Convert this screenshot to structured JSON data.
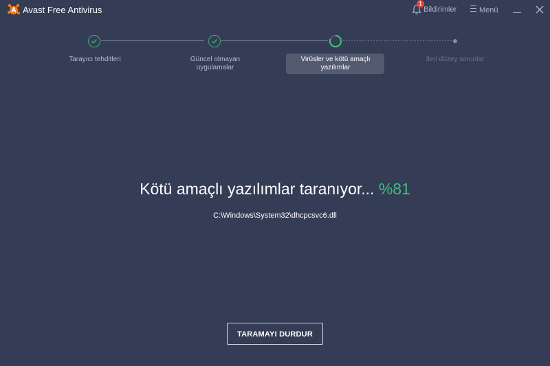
{
  "app": {
    "title": "Avast Free Antivirus"
  },
  "header": {
    "notifications_label": "Bildirimler",
    "notifications_count": "1",
    "menu_label": "Menü"
  },
  "steps": [
    {
      "label_line1": "Tarayıcı tehditleri",
      "label_line2": "",
      "state": "done"
    },
    {
      "label_line1": "Güncel olmayan",
      "label_line2": "uygulamalar",
      "state": "done"
    },
    {
      "label_line1": "Virüsler ve kötü amaçlı",
      "label_line2": "yazılımlar",
      "state": "active"
    },
    {
      "label_line1": "İleri düzey sorunlar",
      "label_line2": "",
      "state": "pending"
    }
  ],
  "scan": {
    "heading": "Kötü amaçlı yazılımlar taranıyor...",
    "percent": "%81",
    "progress": 0.81,
    "current_file": "C:\\Windows\\System32\\dhcpcsvc6.dll"
  },
  "actions": {
    "stop_label": "TARAMAYI DURDUR"
  },
  "colors": {
    "background": "#353c55",
    "accent_green": "#3ec07a",
    "brand_orange": "#f07a1f",
    "badge_red": "#e8413c"
  },
  "icons": [
    "avast-logo-icon",
    "bell-icon",
    "menu-icon",
    "minimize-icon",
    "close-icon",
    "checkmark-icon"
  ]
}
